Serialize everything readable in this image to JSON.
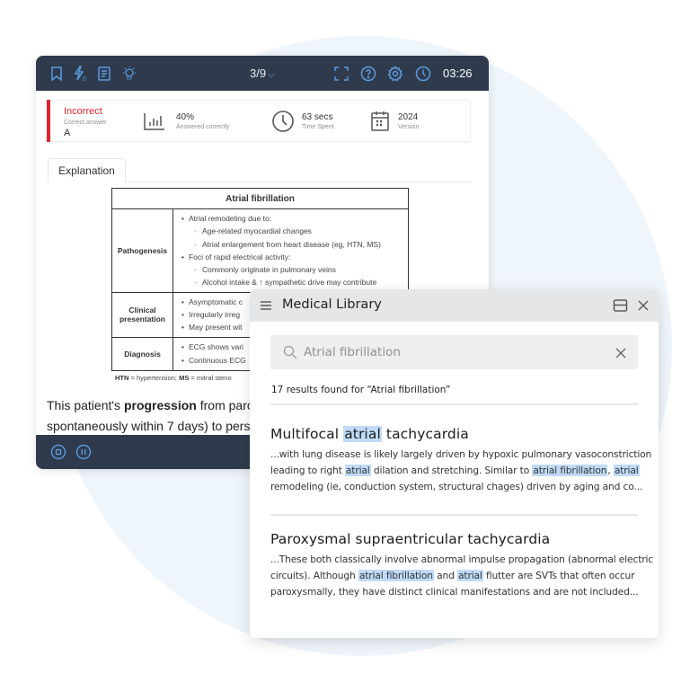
{
  "quiz": {
    "toolbar": {
      "left_icons": [
        "bookmark-icon",
        "flash-card-icon",
        "notebook-icon",
        "lightbulb-icon"
      ],
      "flash_badge": "0",
      "counter": "3/9",
      "right_icons": [
        "fullscreen-icon",
        "help-icon",
        "settings-icon",
        "clock-icon"
      ],
      "timer": "03:26"
    },
    "stats": {
      "status": "Incorrect",
      "correct_answer_label": "Correct answer",
      "correct_answer": "A",
      "percent_value": "40%",
      "percent_label": "Answered correctly",
      "time_value": "63 secs",
      "time_label": "Time Spent",
      "version_value": "2024",
      "version_label": "Version"
    },
    "tabs": [
      {
        "label": "Explanation"
      }
    ],
    "table": {
      "title": "Atrial fibrillation",
      "rows": [
        {
          "header": "Pathogenesis",
          "items": [
            {
              "level": 1,
              "text": "Atrial remodeling due to:"
            },
            {
              "level": 2,
              "text": "Age-related myocardial changes"
            },
            {
              "level": 2,
              "text": "Atrial enlargement from heart disease (eg, HTN, MS)"
            },
            {
              "level": 1,
              "text": "Foci of rapid electrical activity:"
            },
            {
              "level": 2,
              "text": "Commonly originate in pulmonary veins"
            },
            {
              "level": 2,
              "text": "Alcohol intake & ↑ sympathetic drive may contribute"
            }
          ]
        },
        {
          "header": "Clinical presentation",
          "items": [
            {
              "level": 1,
              "text": "Asymptomatic c"
            },
            {
              "level": 1,
              "text": "Irregularly irreg"
            },
            {
              "level": 1,
              "text": "May present wit"
            }
          ]
        },
        {
          "header": "Diagnosis",
          "items": [
            {
              "level": 1,
              "text": "ECG shows vari"
            },
            {
              "level": 1,
              "text": "Continuous ECG"
            }
          ]
        }
      ],
      "footnote": {
        "abbr1": "HTN",
        "def1": " = hypertension; ",
        "abbr2": "MS",
        "def2": " = mitral steno"
      }
    },
    "paragraph": {
      "pre": "This patient's ",
      "bold": "progression",
      "post": " from parc",
      "line2": "spontaneously within 7 days) to persi"
    },
    "bottombar_icons": [
      "stop-icon",
      "pause-icon"
    ]
  },
  "library": {
    "title": "Medical Library",
    "search": {
      "value": "Atrial fibrillation",
      "placeholder": "Search"
    },
    "results_count": "17 results found for “Atrial fibrillation”",
    "highlight_color": "#bfdbf7",
    "results": [
      {
        "title_parts": [
          {
            "text": "Multifocal ",
            "hl": false
          },
          {
            "text": "atrial",
            "hl": true
          },
          {
            "text": " tachycardia",
            "hl": false
          }
        ],
        "lines": [
          [
            {
              "text": "...with lung disease is likely largely driven by hypoxic pulmonary vasoconstriction",
              "hl": false
            }
          ],
          [
            {
              "text": "leading to right ",
              "hl": false
            },
            {
              "text": "atrial",
              "hl": true
            },
            {
              "text": " dilation and stretching. Similar to ",
              "hl": false
            },
            {
              "text": "atrial fibrillation",
              "hl": true
            },
            {
              "text": ", ",
              "hl": false
            },
            {
              "text": "atrial",
              "hl": true
            }
          ],
          [
            {
              "text": "remodeling (ie, conduction system, structural chages) driven by aging and co...",
              "hl": false
            }
          ]
        ]
      },
      {
        "title_parts": [
          {
            "text": "Paroxysmal supraentricular tachycardia",
            "hl": false
          }
        ],
        "lines": [
          [
            {
              "text": "...These both classically involve abnormal impulse propagation (abnormal electric",
              "hl": false
            }
          ],
          [
            {
              "text": "circuits). Although ",
              "hl": false
            },
            {
              "text": "atrial fibrillation",
              "hl": true
            },
            {
              "text": " and ",
              "hl": false
            },
            {
              "text": "atrial",
              "hl": true
            },
            {
              "text": " flutter are SVTs that often occur",
              "hl": false
            }
          ],
          [
            {
              "text": "paroxysmally, they have distinct clinical manifestations and are not included...",
              "hl": false
            }
          ]
        ]
      }
    ]
  }
}
